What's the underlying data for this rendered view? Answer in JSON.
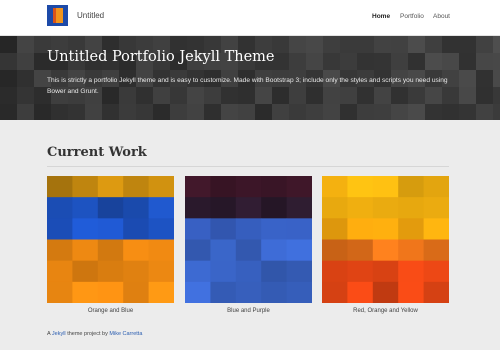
{
  "brand": {
    "name": "Untitled"
  },
  "nav": {
    "items": [
      "Home",
      "Portfolio",
      "About"
    ],
    "active": "Home"
  },
  "hero": {
    "title": "Untitled Portfolio Jekyll Theme",
    "description": "This is strictly a portfolio Jekyll theme and is easy to customize. Made with Bootstrap 3; include only the styles and scripts you need using Bower and Grunt."
  },
  "work": {
    "title": "Current Work",
    "items": [
      {
        "caption": "Orange and Blue",
        "colors": [
          "#c2870f",
          "#1c4fb8",
          "#1e55c9",
          "#f08a12"
        ]
      },
      {
        "caption": "Blue and Purple",
        "colors": [
          "#3a1526",
          "#2b1a2d",
          "#3358b2",
          "#3a65c8"
        ]
      },
      {
        "caption": "Red, Orange and Yellow",
        "colors": [
          "#f2b010",
          "#f0a40e",
          "#e8721a",
          "#e04414"
        ]
      }
    ]
  },
  "footer": {
    "prefix": "A ",
    "link1": "Jekyll",
    "middle": " theme project by ",
    "link2": "Mike Carretta"
  }
}
